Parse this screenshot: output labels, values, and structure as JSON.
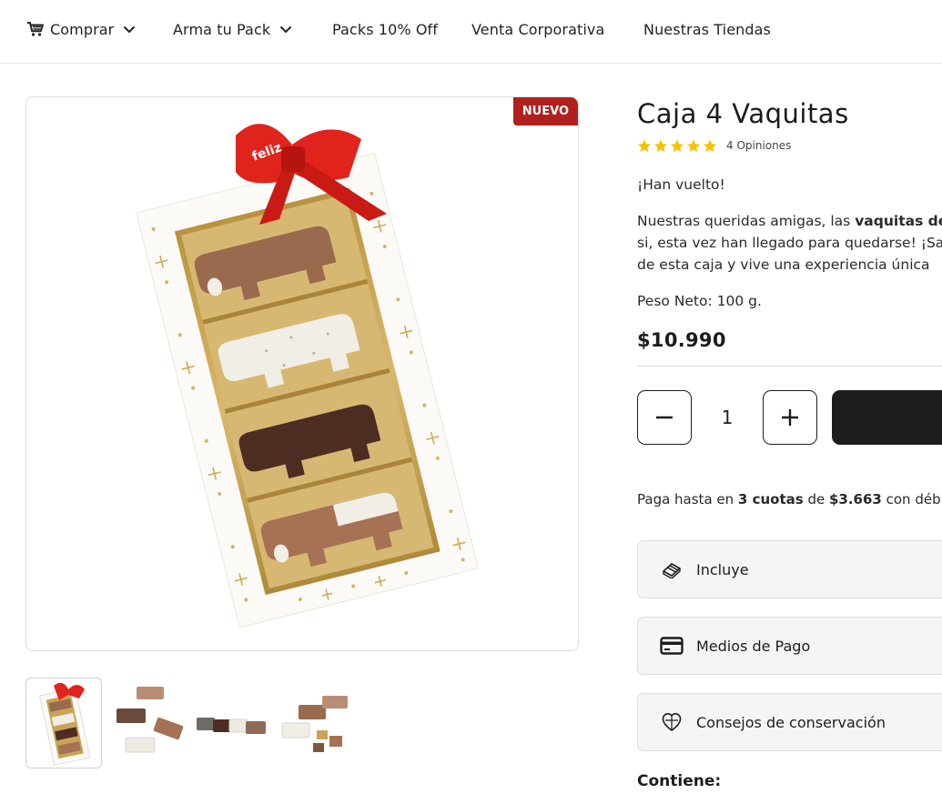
{
  "nav": {
    "items": [
      {
        "label": "Comprar",
        "has_dropdown": true,
        "icon": "cart-icon"
      },
      {
        "label": "Arma tu Pack",
        "has_dropdown": true
      },
      {
        "label": "Packs 10% Off",
        "has_dropdown": false
      },
      {
        "label": "Venta Corporativa",
        "has_dropdown": false
      },
      {
        "label": "Nuestras Tiendas",
        "has_dropdown": false
      }
    ]
  },
  "gallery": {
    "badge": "NUEVO",
    "ribbon_text": "feliz",
    "thumbnails": [
      "box-front",
      "cows-scattered",
      "cows-row",
      "cows-with-pieces"
    ],
    "active_thumbnail": 0
  },
  "product": {
    "title": "Caja 4 Vaquitas",
    "rating": 5,
    "reviews": "4 Opiniones",
    "intro": "¡Han vuelto!",
    "desc_line1_pre": "Nuestras queridas amigas, las ",
    "desc_line1_bold": "vaquitas de",
    "desc_line2": "si, esta vez han llegado para quedarse! ¡Sa",
    "desc_line3": "de esta caja y vive una experiencia única",
    "net_weight": "Peso Neto: 100 g.",
    "price": "$10.990"
  },
  "cart": {
    "quantity": "1",
    "minus_icon": "minus-icon",
    "plus_icon": "plus-icon"
  },
  "payment": {
    "pre": "Paga hasta en ",
    "installments": "3 cuotas",
    "mid": " de ",
    "amount": "$3.663",
    "post": " con déb"
  },
  "accordions": [
    {
      "label": "Incluye",
      "icon": "chocolate-bar-icon"
    },
    {
      "label": "Medios de Pago",
      "icon": "credit-card-icon"
    },
    {
      "label": "Consejos de conservación",
      "icon": "heart-shield-icon"
    }
  ],
  "contains_heading": "Contiene:",
  "colors": {
    "badge": "#b0201e",
    "ribbon": "#e0231c",
    "star": "#f2c200",
    "button_dark": "#1d1d1d",
    "accordion_bg": "#f5f5f5"
  }
}
